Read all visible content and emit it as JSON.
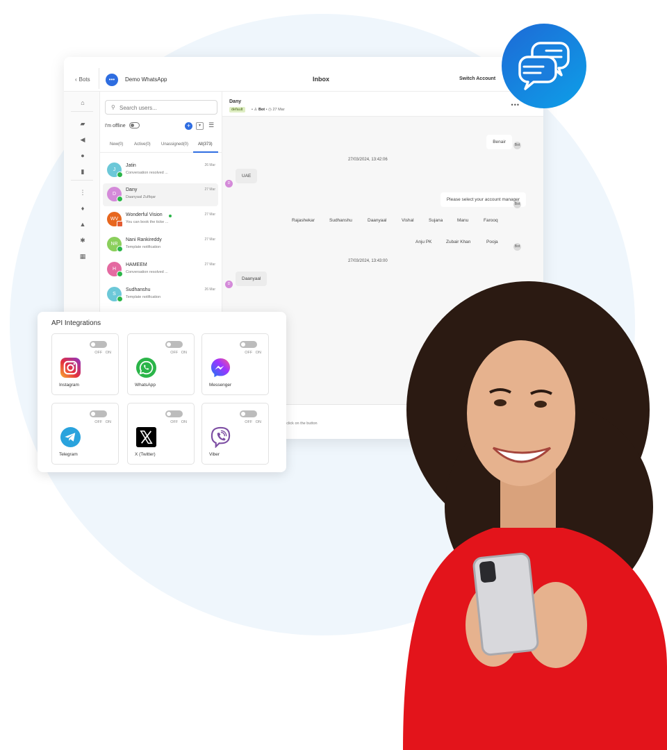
{
  "topbar": {
    "back_label": "Bots",
    "brand_name": "Demo WhatsApp",
    "title": "Inbox",
    "switch_account": "Switch Account"
  },
  "sidebar_icons": [
    "home-icon",
    "inbox-icon",
    "megaphone-icon",
    "users-icon",
    "bar-chart-icon",
    "flow-icon",
    "bulb-icon",
    "sitemap-icon",
    "gear-icon",
    "grid-icon"
  ],
  "list": {
    "search_placeholder": "Search users...",
    "offline_label": "I'm offline",
    "tabs": [
      "New(0)",
      "Active(0)",
      "Unassigned(0)",
      "All(373)"
    ],
    "active_tab": "All(373)",
    "conversations": [
      {
        "initials": "J",
        "name": "Jatin",
        "preview": "Conversation resolved ...",
        "date": "26 Mar",
        "color": "#6cc8d8",
        "channel": "whatsapp"
      },
      {
        "initials": "D",
        "name": "Dany",
        "preview": "Daanyaal Zulfiqar",
        "date": "27 Mar",
        "color": "#d48ad9",
        "channel": "whatsapp"
      },
      {
        "initials": "WV",
        "name": "Wonderful Vision",
        "preview": "You can book the ticke ...",
        "date": "27 Mar",
        "color": "#e7671f",
        "channel": "web"
      },
      {
        "initials": "NR",
        "name": "Nani Rankireddy",
        "preview": "Template notification",
        "date": "27 Mar",
        "color": "#8bcf5c",
        "channel": "whatsapp"
      },
      {
        "initials": "H",
        "name": "HAMEEM",
        "preview": "Conversation resolved ...",
        "date": "27 Mar",
        "color": "#e46aa1",
        "channel": "whatsapp"
      },
      {
        "initials": "S",
        "name": "Sudhanshu",
        "preview": "Template notification",
        "date": "26 Mar",
        "color": "#6cc8d8",
        "channel": "whatsapp"
      }
    ]
  },
  "chat": {
    "name": "Dany",
    "tag": "default",
    "assignee": "Bot",
    "date": "27 Mar",
    "messages": {
      "benair": "Benair",
      "ts1": "27/03/2024, 13:42:06",
      "uae": "UAE",
      "prompt": "Please select your account manager",
      "ts2": "27/03/2024, 13:43:00",
      "daanyaal": "Daanyaal"
    },
    "options_row1": [
      "Rajashekar",
      "Sudhanshu",
      "Daanyaal",
      "Vishal",
      "Sujana",
      "Manu",
      "Farooq"
    ],
    "options_row2": [
      "Anju PK",
      "Zubair Khan",
      "Pooja"
    ],
    "composer_hint": "age, click on the button",
    "bot_initials": "Bot",
    "user_initial": "D"
  },
  "api_integrations": {
    "title": "API Integrations",
    "off_label": "OFF",
    "on_label": "ON",
    "items": [
      {
        "label": "Instagram",
        "icon": "instagram-icon"
      },
      {
        "label": "WhatsApp",
        "icon": "whatsapp-icon"
      },
      {
        "label": "Messenger",
        "icon": "messenger-icon"
      },
      {
        "label": "Telegram",
        "icon": "telegram-icon"
      },
      {
        "label": "X (Twitter)",
        "icon": "x-twitter-icon"
      },
      {
        "label": "Viber",
        "icon": "viber-icon"
      }
    ]
  },
  "colors": {
    "accent": "#2f6de1",
    "badge_gradient_start": "#1c6fd8",
    "badge_gradient_end": "#0f9ae6",
    "whatsapp_green": "#2bb549"
  }
}
